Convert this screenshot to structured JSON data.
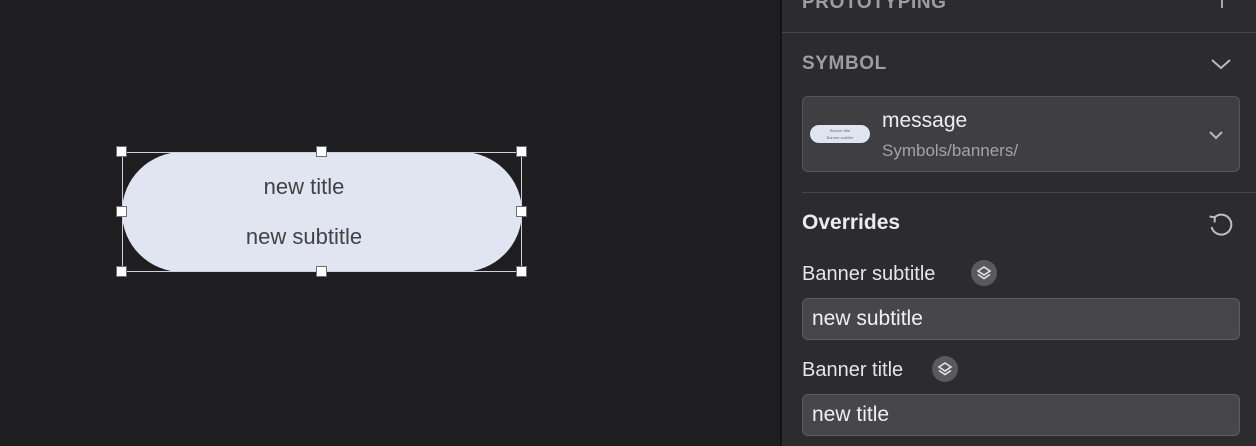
{
  "canvas": {
    "banner": {
      "title": "new title",
      "subtitle": "new subtitle",
      "fill_color": "#e0e5f1"
    }
  },
  "inspector": {
    "prototyping": {
      "label": "PROTOTYPING",
      "add_icon": "plus-icon"
    },
    "symbol": {
      "label": "SYMBOL",
      "collapse_icon": "chevron-down-icon",
      "name": "message",
      "path": "Symbols/banners/",
      "thumbnail": {
        "title": "Banner title",
        "subtitle": "Banner subtitle"
      },
      "picker_icon": "chevron-down-icon"
    },
    "overrides": {
      "label": "Overrides",
      "reset_icon": "reset-icon",
      "fields": [
        {
          "label": "Banner subtitle",
          "value": "new subtitle",
          "icon": "layers-icon"
        },
        {
          "label": "Banner title",
          "value": "new title",
          "icon": "layers-icon"
        }
      ]
    }
  }
}
